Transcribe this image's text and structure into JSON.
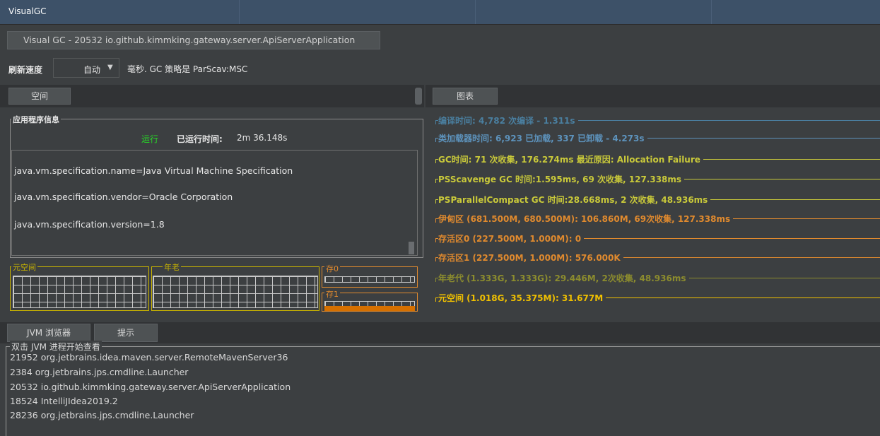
{
  "window": {
    "title": "VisualGC"
  },
  "document_tab": {
    "label": "Visual GC - 20532 io.github.kimmking.gateway.server.ApiServerApplication"
  },
  "refresh": {
    "label": "刷新速度",
    "selected": "自动",
    "suffix": "毫秒. GC 策略是 ParScav:MSC"
  },
  "tabs": {
    "space": "空间",
    "chart": "图表"
  },
  "app_info": {
    "legend": "应用程序信息",
    "status": "运行",
    "uptime_label": "已运行时间:",
    "uptime_value": "2m 36.148s",
    "properties": [
      "java.vm.specification.name=Java Virtual Machine Specification",
      "java.vm.specification.vendor=Oracle Corporation",
      "java.vm.specification.version=1.8"
    ]
  },
  "memory_spaces": {
    "metaspace": "元空间",
    "old_gen": "年老",
    "survivor0": "存0",
    "survivor1": "存1"
  },
  "graphs": [
    {
      "text": "编译时间: 4,782 次编译 - 1.311s",
      "color": "#4a7fa0"
    },
    {
      "text": "类加载器时间: 6,923 已加载, 337 已卸载 - 4.273s",
      "color": "#5d93bd"
    },
    {
      "text": "GC时间: 71 次收集, 176.274ms 最近原因: Allocation Failure",
      "color": "#c9c93a"
    },
    {
      "text": "PSScavenge GC 时间:1.595ms, 69 次收集, 127.338ms",
      "color": "#c9c93a"
    },
    {
      "text": "PSParallelCompact GC 时间:28.668ms, 2 次收集, 48.936ms",
      "color": "#c9c93a"
    },
    {
      "text": "伊甸区 (681.500M, 680.500M): 106.860M, 69次收集, 127.338ms",
      "color": "#e08a2e"
    },
    {
      "text": "存活区0 (227.500M, 1.000M): 0",
      "color": "#e08a2e"
    },
    {
      "text": "存活区1 (227.500M, 1.000M): 576.000K",
      "color": "#e08a2e"
    },
    {
      "text": "年老代 (1.333G, 1.333G): 29.446M, 2次收集, 48.936ms",
      "color": "#8c8c2e"
    },
    {
      "text": "元空间 (1.018G, 35.375M): 31.677M",
      "color": "#f0c000"
    }
  ],
  "bottom_tabs": {
    "jvm_browser": "JVM 浏览器",
    "hint": "提示"
  },
  "processes": {
    "legend": "双击 JVM 进程开始查看",
    "items": [
      "21952 org.jetbrains.idea.maven.server.RemoteMavenServer36",
      "2384 org.jetbrains.jps.cmdline.Launcher",
      "20532 io.github.kimmking.gateway.server.ApiServerApplication",
      "18524 IntelliJIdea2019.2",
      "28236 org.jetbrains.jps.cmdline.Launcher"
    ]
  },
  "colors": {
    "running": "#27d827",
    "metaspace": "#c9b400",
    "old_gen": "#c9b400",
    "survivor": "#e08a2e",
    "survivor1_fill": "#d67000"
  }
}
